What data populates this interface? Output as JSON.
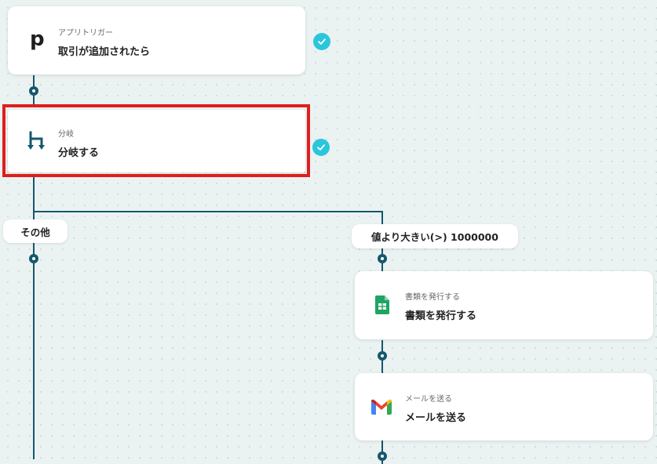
{
  "colors": {
    "canvas": "#ebf2f2",
    "connector": "#14586e",
    "check": "#2bc6dc",
    "highlight": "#e01e1e"
  },
  "steps": {
    "trigger": {
      "icon": "p-logo-icon",
      "subtitle": "アプリトリガー",
      "title": "取引が追加されたら",
      "status_icon": "check-icon"
    },
    "branch": {
      "icon": "branch-icon",
      "subtitle": "分岐",
      "title": "分岐する",
      "status_icon": "check-icon",
      "highlighted": true
    },
    "issue_document": {
      "icon": "google-sheets-icon",
      "subtitle": "書類を発行する",
      "title": "書類を発行する"
    },
    "send_mail": {
      "icon": "gmail-icon",
      "subtitle": "メールを送る",
      "title": "メールを送る"
    }
  },
  "branches": {
    "other_label": "その他",
    "condition_label": "値より大きい(>) 1000000"
  }
}
